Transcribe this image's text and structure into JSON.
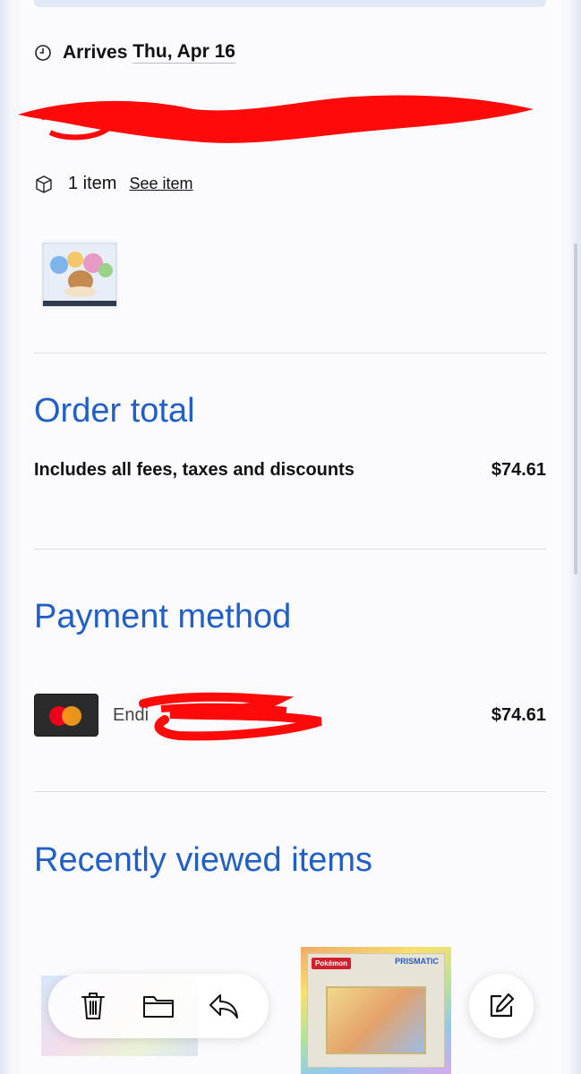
{
  "shipment": {
    "arrives_label": "Arrives",
    "arrives_date": "Thu, Apr 16",
    "item_count": "1 item",
    "see_item": "See item"
  },
  "order_total": {
    "title": "Order total",
    "description": "Includes all fees, taxes and discounts",
    "amount": "$74.61"
  },
  "payment": {
    "title": "Payment method",
    "card_label": "Endi",
    "amount": "$74.61"
  },
  "recently_viewed": {
    "title": "Recently viewed items",
    "product_brand": "Pokémon",
    "product_series": "PRISMATIC"
  },
  "colors": {
    "accent": "#1f5fc6",
    "redaction": "#ff0000"
  }
}
